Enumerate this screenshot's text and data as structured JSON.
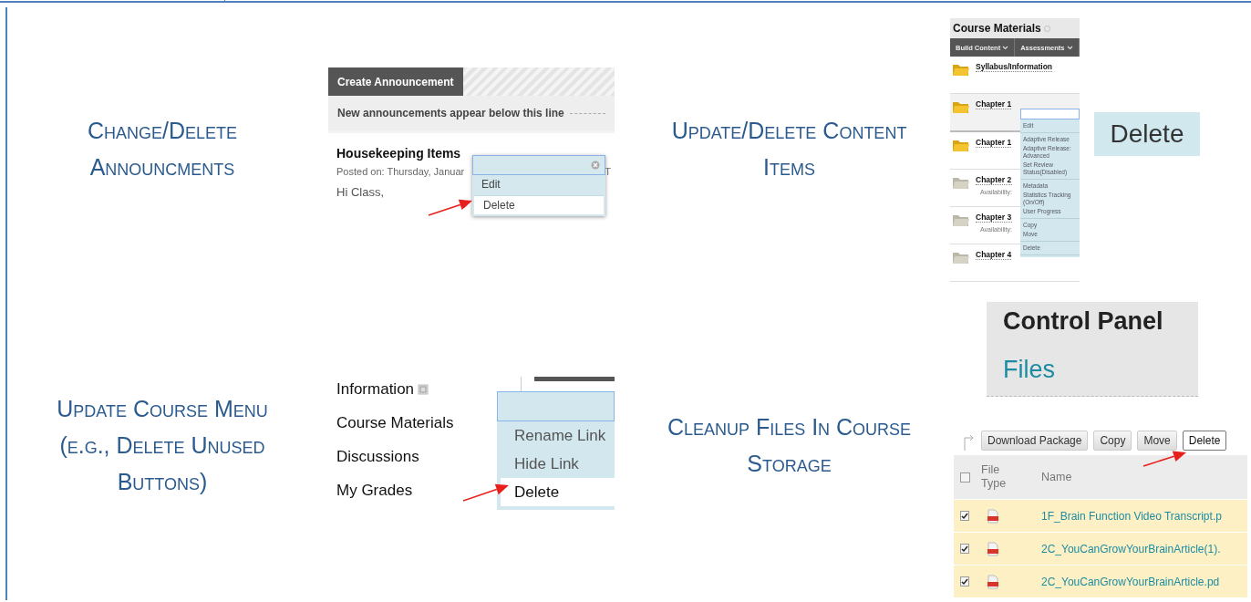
{
  "sections": [
    {
      "kind": "announcements",
      "heading": "Change/Delete Announcments",
      "screenshot": {
        "tab": "Create Announcement",
        "notice": "New announcements appear below this line",
        "title": "Housekeeping Items",
        "posted": "Posted on: Thursday, Januar",
        "posted_tail": "T",
        "body": "Hi Class,",
        "menu": [
          {
            "label": "Edit",
            "selected": false
          },
          {
            "label": "Delete",
            "selected": true
          }
        ]
      }
    },
    {
      "kind": "content",
      "heading": "Update/Delete Content Items",
      "screenshot": {
        "title": "Course Materials",
        "toolbar": [
          "Build Content",
          "Assessments"
        ],
        "items": [
          {
            "name": "Syllabus/Information",
            "available": true
          },
          {
            "name": "Chapter 1",
            "available": true
          },
          {
            "name": "Chapter 1",
            "available": true
          },
          {
            "name": "Chapter 2",
            "available": false,
            "note": "Availability:"
          },
          {
            "name": "Chapter 3",
            "available": false,
            "note": "Availability:"
          },
          {
            "name": "Chapter 4",
            "available": false
          }
        ],
        "menu": [
          [
            "Edit"
          ],
          [
            "Adaptive Release",
            "Adaptive Release: Advanced",
            "Set Review Status(Disabled)"
          ],
          [
            "Metadata",
            "Statistics Tracking (On/Off)",
            "User Progress"
          ],
          [
            "Copy",
            "Move"
          ],
          [
            "Delete"
          ]
        ],
        "callout": "Delete"
      }
    },
    {
      "kind": "course_menu",
      "heading": "Update Course Menu (e.g., Delete Unused Buttons)",
      "screenshot": {
        "links": [
          "Information",
          "Course Materials",
          "Discussions",
          "My Grades"
        ],
        "menu": [
          {
            "label": "Rename Link",
            "selected": false
          },
          {
            "label": "Hide Link",
            "selected": false
          },
          {
            "label": "Delete",
            "selected": true
          }
        ]
      }
    },
    {
      "kind": "files",
      "heading": "Cleanup Files In Course Storage",
      "screenshot": {
        "panel_title": "Control Panel",
        "panel_link": "Files",
        "buttons": [
          {
            "label": "Download Package",
            "selected": false
          },
          {
            "label": "Copy",
            "selected": false
          },
          {
            "label": "Move",
            "selected": false
          },
          {
            "label": "Delete",
            "selected": true
          }
        ],
        "select_all": {
          "checked": false
        },
        "columns": [
          "File Type",
          "Name"
        ],
        "rows": [
          {
            "checked": true,
            "name": "1F_Brain Function Video Transcript.p"
          },
          {
            "checked": true,
            "name": "2C_YouCanGrowYourBrainArticle(1)."
          },
          {
            "checked": true,
            "name": "2C_YouCanGrowYourBrainArticle.pd"
          }
        ]
      }
    }
  ]
}
